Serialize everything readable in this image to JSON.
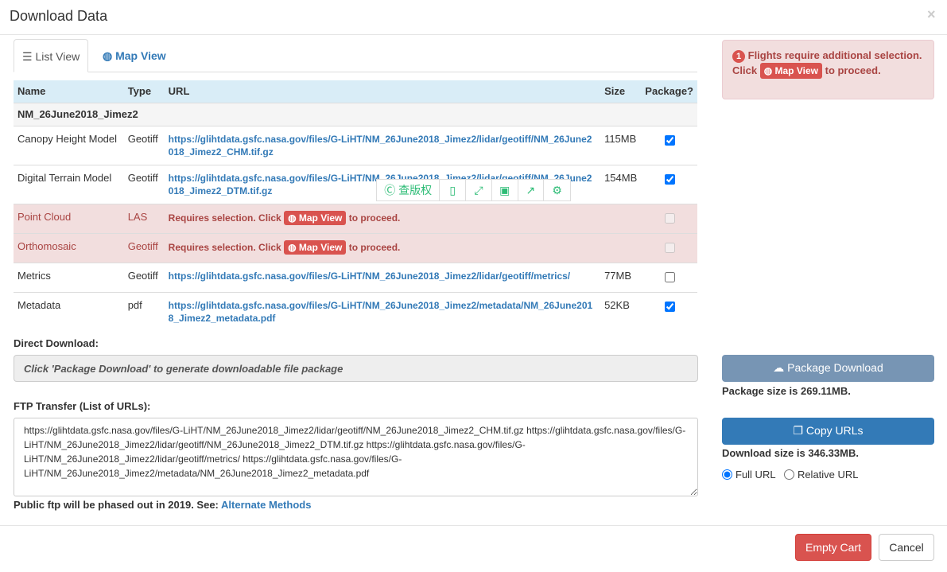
{
  "header": {
    "title": "Download Data",
    "close": "×"
  },
  "tabs": [
    {
      "label": "List View",
      "icon": "list-icon"
    },
    {
      "label": "Map View",
      "icon": "globe-icon"
    }
  ],
  "table": {
    "columns": [
      "Name",
      "Type",
      "URL",
      "Size",
      "Package?"
    ],
    "group": "NM_26June2018_Jimez2",
    "rows": [
      {
        "name": "Canopy Height Model",
        "type": "Geotiff",
        "url": "https://glihtdata.gsfc.nasa.gov/files/G-LiHT/NM_26June2018_Jimez2/lidar/geotiff/NM_26June2018_Jimez2_CHM.tif.gz",
        "size": "115MB",
        "checked": true
      },
      {
        "name": "Digital Terrain Model",
        "type": "Geotiff",
        "url": "https://glihtdata.gsfc.nasa.gov/files/G-LiHT/NM_26June2018_Jimez2/lidar/geotiff/NM_26June2018_Jimez2_DTM.tif.gz",
        "size": "154MB",
        "checked": true
      },
      {
        "name": "Point Cloud",
        "type": "LAS",
        "requires": "Requires selection. Click",
        "btn": "Map View",
        "after": "to proceed.",
        "checked": false
      },
      {
        "name": "Orthomosaic",
        "type": "Geotiff",
        "requires": "Requires selection. Click",
        "btn": "Map View",
        "after": "to proceed.",
        "checked": false
      },
      {
        "name": "Metrics",
        "type": "Geotiff",
        "url": "https://glihtdata.gsfc.nasa.gov/files/G-LiHT/NM_26June2018_Jimez2/lidar/geotiff/metrics/",
        "size": "77MB",
        "checked": false
      },
      {
        "name": "Metadata",
        "type": "pdf",
        "url": "https://glihtdata.gsfc.nasa.gov/files/G-LiHT/NM_26June2018_Jimez2/metadata/NM_26June2018_Jimez2_metadata.pdf",
        "size": "52KB",
        "checked": true
      }
    ]
  },
  "toolbar": {
    "copyright_label": "查版权"
  },
  "direct": {
    "label": "Direct Download:",
    "placeholder": "Click 'Package Download' to generate downloadable file package"
  },
  "ftp": {
    "label": "FTP Transfer (List of URLs):",
    "value": "https://glihtdata.gsfc.nasa.gov/files/G-LiHT/NM_26June2018_Jimez2/lidar/geotiff/NM_26June2018_Jimez2_CHM.tif.gz https://glihtdata.gsfc.nasa.gov/files/G-LiHT/NM_26June2018_Jimez2/lidar/geotiff/NM_26June2018_Jimez2_DTM.tif.gz https://glihtdata.gsfc.nasa.gov/files/G-LiHT/NM_26June2018_Jimez2/lidar/geotiff/metrics/ https://glihtdata.gsfc.nasa.gov/files/G-LiHT/NM_26June2018_Jimez2/metadata/NM_26June2018_Jimez2_metadata.pdf",
    "note": "Public ftp will be phased out in 2019. See:",
    "link": "Alternate Methods"
  },
  "alert": {
    "count": "1",
    "line1": "Flights require additional selection.",
    "click": "Click",
    "btn": "Map View",
    "after": "to proceed."
  },
  "package": {
    "button": "Package Download",
    "size": "Package size is 269.11MB."
  },
  "copy": {
    "button": "Copy URLs",
    "size": "Download size is 346.33MB."
  },
  "url_mode": {
    "options": [
      "Full URL",
      "Relative URL"
    ],
    "selected": "Full URL"
  },
  "footer": {
    "empty": "Empty Cart",
    "cancel": "Cancel"
  },
  "colors": {
    "danger": "#d9534f",
    "primary": "#337ab7",
    "package_disabled": "#7795b4"
  }
}
